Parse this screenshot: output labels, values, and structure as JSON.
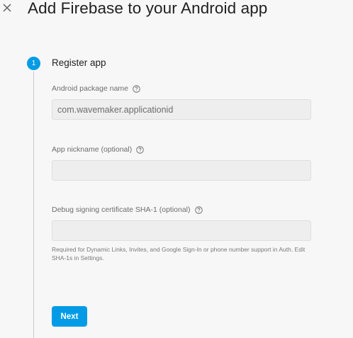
{
  "header": {
    "close_icon": "close-icon",
    "title": "Add Firebase to your Android app"
  },
  "step": {
    "number": "1",
    "title": "Register app"
  },
  "form": {
    "package_name": {
      "label": "Android package name",
      "placeholder": "com.wavemaker.applicationid",
      "value": ""
    },
    "nickname": {
      "label": "App nickname (optional)",
      "placeholder": "",
      "value": ""
    },
    "sha1": {
      "label": "Debug signing certificate SHA-1 (optional)",
      "placeholder": "",
      "value": "",
      "helper": "Required for Dynamic Links, Invites, and Google Sign-In or phone number support in Auth. Edit SHA-1s in Settings."
    },
    "help_icon": "help-circle-icon"
  },
  "actions": {
    "next_label": "Next"
  },
  "colors": {
    "accent": "#039be5",
    "background": "#f7f7f7",
    "field_background": "#eeeeee"
  }
}
